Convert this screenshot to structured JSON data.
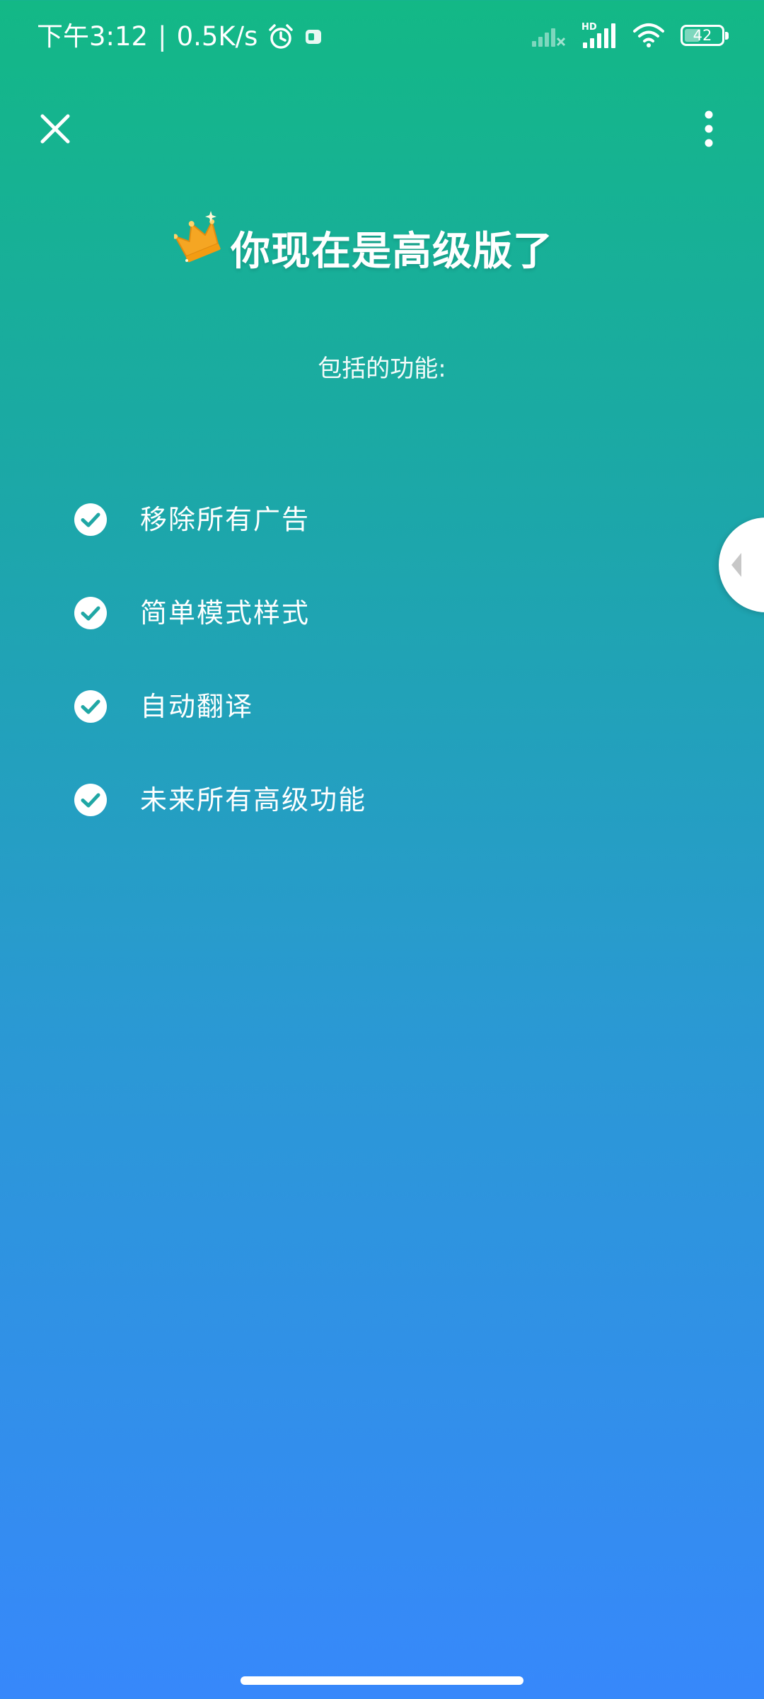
{
  "status_bar": {
    "time": "下午3:12",
    "separator": "|",
    "network_speed": "0.5K/s",
    "hd_label": "HD",
    "battery": "42",
    "battery_level": 0.42,
    "icons": [
      "alarm-icon",
      "notification-icon",
      "signal-icon",
      "hd-signal-icon",
      "wifi-icon",
      "battery-icon"
    ]
  },
  "toolbar": {
    "close_icon": "close-icon",
    "more_icon": "more-vertical-icon"
  },
  "header": {
    "title": "你现在是高级版了",
    "crown_icon": "crown-icon",
    "subtitle": "包括的功能:"
  },
  "features": [
    {
      "label": "移除所有广告",
      "icon": "check-circle-icon"
    },
    {
      "label": "简单模式样式",
      "icon": "check-circle-icon"
    },
    {
      "label": "自动翻译",
      "icon": "check-circle-icon"
    },
    {
      "label": "未来所有高级功能",
      "icon": "check-circle-icon"
    }
  ],
  "colors": {
    "gradient_top": "#13b886",
    "gradient_bottom": "#3788fb",
    "check_color": "#20a7a5",
    "crown_color": "#f5a623"
  }
}
